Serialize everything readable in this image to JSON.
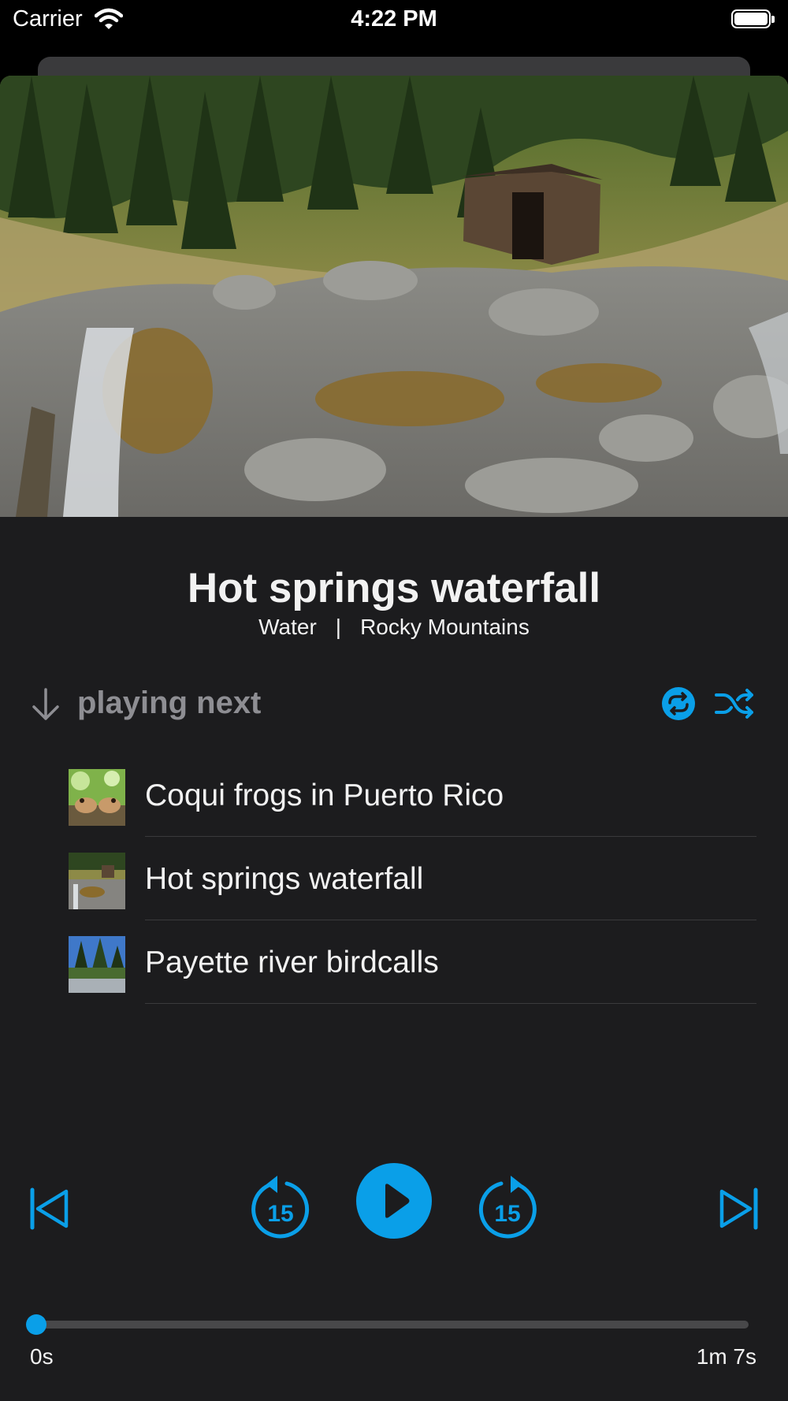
{
  "status_bar": {
    "carrier": "Carrier",
    "time": "4:22 PM"
  },
  "now_playing": {
    "title": "Hot springs waterfall",
    "category": "Water",
    "location": "Rocky Mountains",
    "separator": "|"
  },
  "queue": {
    "header_label": "playing next",
    "items": [
      {
        "label": "Coqui frogs in Puerto Rico"
      },
      {
        "label": "Hot springs waterfall"
      },
      {
        "label": "Payette river birdcalls"
      }
    ]
  },
  "controls": {
    "skip_back_seconds": "15",
    "skip_forward_seconds": "15"
  },
  "progress": {
    "elapsed": "0s",
    "duration": "1m 7s",
    "fraction": 0.0
  },
  "colors": {
    "accent": "#0a9fe8",
    "background": "#1c1c1e"
  }
}
